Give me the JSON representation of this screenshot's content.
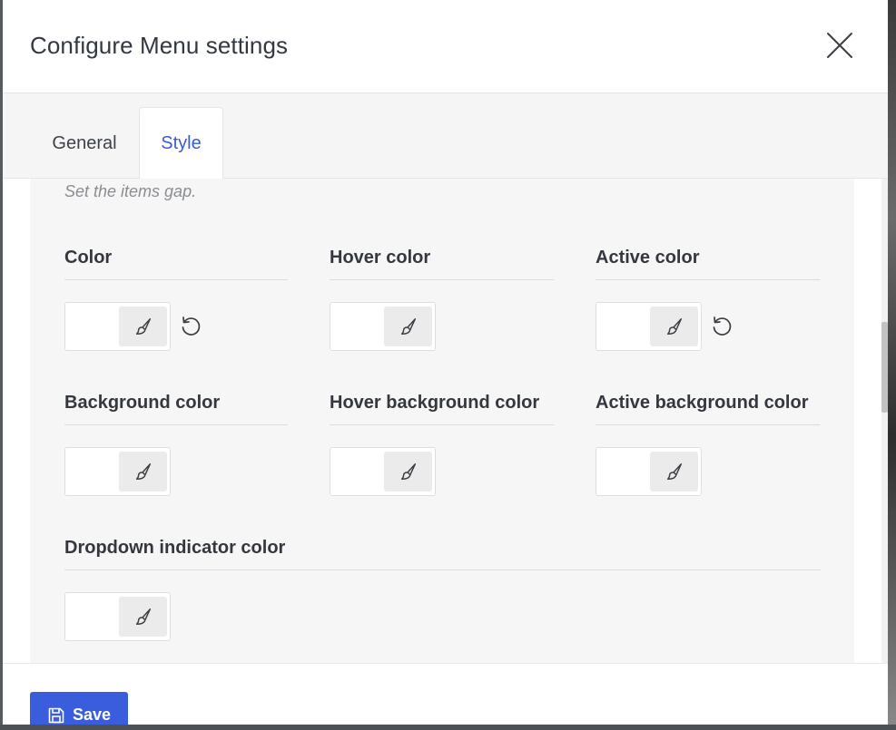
{
  "modal": {
    "title": "Configure Menu settings"
  },
  "tabs": [
    {
      "label": "General",
      "active": false
    },
    {
      "label": "Style",
      "active": true
    }
  ],
  "style_panel": {
    "help_text": "Set the items gap.",
    "fields": [
      {
        "label": "Color",
        "value": "#ffffff",
        "has_reset": true
      },
      {
        "label": "Hover color",
        "value": "#ffffff",
        "has_reset": false
      },
      {
        "label": "Active color",
        "value": "#ffffff",
        "has_reset": true
      },
      {
        "label": "Background color",
        "value": "#ffffff",
        "has_reset": false
      },
      {
        "label": "Hover background color",
        "value": "#ffffff",
        "has_reset": false
      },
      {
        "label": "Active background color",
        "value": "#ffffff",
        "has_reset": false
      },
      {
        "label": "Dropdown indicator color",
        "value": "#ffffff",
        "has_reset": false
      }
    ]
  },
  "footer": {
    "save_label": "Save"
  },
  "icons": {
    "close": "close-icon",
    "picker": "brush-icon",
    "reset": "reset-icon",
    "save": "floppy-disk-icon"
  },
  "colors": {
    "accent": "#3a5dde",
    "active_tab_text": "#3b5bd9",
    "panel_bg": "#f6f6f6"
  }
}
